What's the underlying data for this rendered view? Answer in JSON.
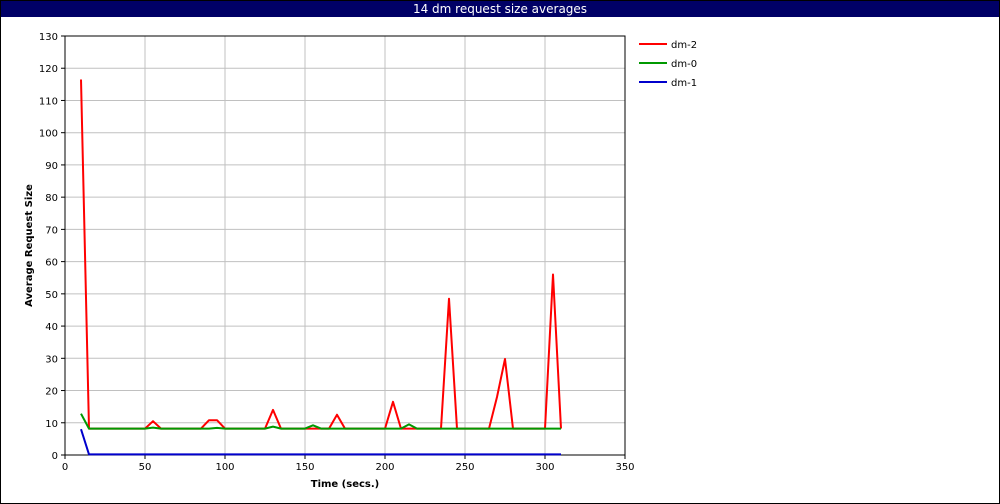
{
  "window": {
    "title": "14 dm request size averages"
  },
  "colors": {
    "title_bg": "#000066",
    "grid": "#c0c0c0"
  },
  "chart_data": {
    "type": "line",
    "title": "14 dm request size averages",
    "xlabel": "Time (secs.)",
    "ylabel": "Average Request Size",
    "xlim": [
      0,
      350
    ],
    "ylim": [
      0,
      130
    ],
    "xticks": [
      0,
      50,
      100,
      150,
      200,
      250,
      300,
      350
    ],
    "yticks": [
      0,
      10,
      20,
      30,
      40,
      50,
      60,
      70,
      80,
      90,
      100,
      110,
      120,
      130
    ],
    "grid": true,
    "legend_position": "top-right, outside plot",
    "series": [
      {
        "name": "dm-2",
        "color": "#ff0000",
        "x": [
          10,
          15,
          20,
          25,
          30,
          35,
          40,
          45,
          50,
          55,
          60,
          65,
          70,
          75,
          80,
          85,
          90,
          95,
          100,
          105,
          110,
          115,
          120,
          125,
          130,
          135,
          140,
          145,
          150,
          155,
          160,
          165,
          170,
          175,
          180,
          185,
          190,
          195,
          200,
          205,
          210,
          215,
          220,
          225,
          230,
          235,
          240,
          245,
          250,
          255,
          260,
          265,
          270,
          275,
          280,
          285,
          290,
          295,
          300,
          305,
          310
        ],
        "y": [
          116.5,
          8.2,
          8.2,
          8.2,
          8.2,
          8.2,
          8.2,
          8.2,
          8.2,
          10.5,
          8.2,
          8.2,
          8.2,
          8.2,
          8.2,
          8.2,
          10.8,
          10.8,
          8.2,
          8.2,
          8.2,
          8.2,
          8.2,
          8.2,
          14.0,
          8.2,
          8.2,
          8.2,
          8.2,
          8.2,
          8.2,
          8.2,
          12.5,
          8.2,
          8.2,
          8.2,
          8.2,
          8.2,
          8.2,
          16.5,
          8.2,
          8.2,
          8.2,
          8.2,
          8.2,
          8.2,
          48.5,
          8.2,
          8.2,
          8.2,
          8.2,
          8.2,
          18.0,
          29.8,
          8.2,
          8.2,
          8.2,
          8.2,
          8.2,
          56.0,
          8.2
        ]
      },
      {
        "name": "dm-0",
        "color": "#009900",
        "x": [
          10,
          15,
          50,
          55,
          60,
          90,
          95,
          100,
          125,
          130,
          135,
          150,
          155,
          160,
          210,
          215,
          220,
          310
        ],
        "y": [
          12.8,
          8.2,
          8.2,
          8.5,
          8.2,
          8.2,
          8.4,
          8.2,
          8.2,
          8.8,
          8.2,
          8.2,
          9.2,
          8.2,
          8.2,
          9.5,
          8.2,
          8.2
        ]
      },
      {
        "name": "dm-1",
        "color": "#0000cc",
        "x": [
          10,
          15,
          310
        ],
        "y": [
          8.0,
          0.2,
          0.2
        ]
      }
    ]
  }
}
